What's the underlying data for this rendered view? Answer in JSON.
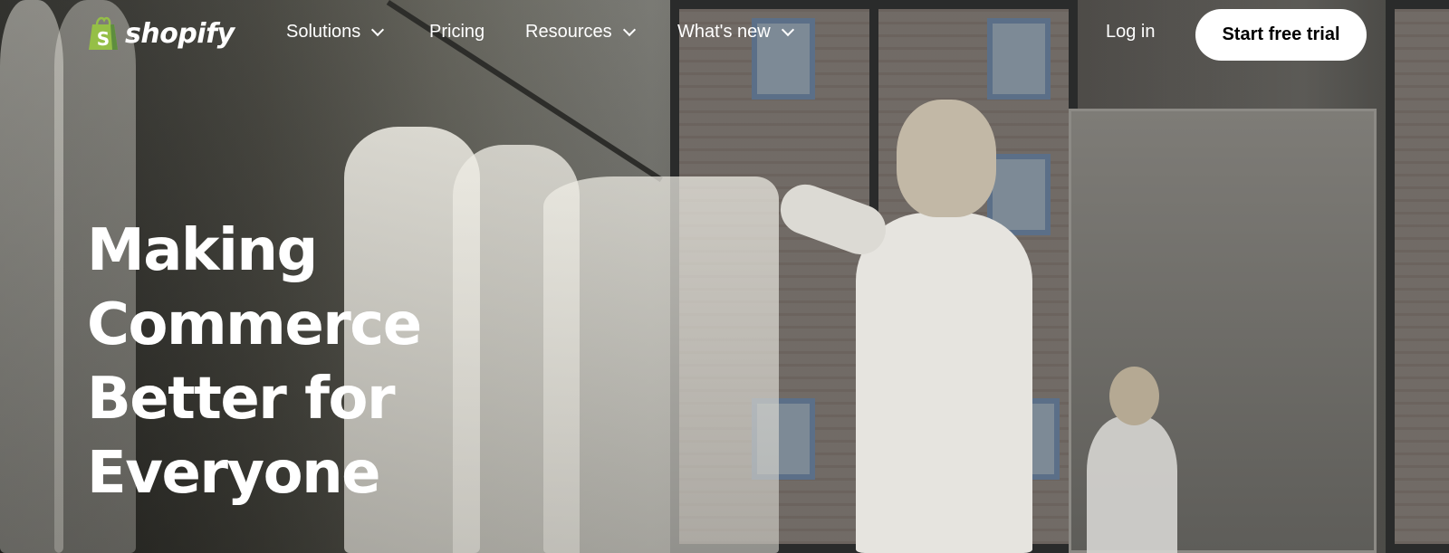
{
  "brand": {
    "name": "shopify",
    "logo_color": "#95bf47",
    "logo_dark": "#5e8e3e"
  },
  "nav": {
    "items": [
      {
        "label": "Solutions",
        "has_dropdown": true
      },
      {
        "label": "Pricing",
        "has_dropdown": false
      },
      {
        "label": "Resources",
        "has_dropdown": true
      },
      {
        "label": "What's new",
        "has_dropdown": true
      }
    ],
    "login_label": "Log in",
    "cta_label": "Start free trial"
  },
  "hero": {
    "headline_lines": [
      "Making",
      "Commerce",
      "Better for",
      "Everyone"
    ],
    "image_description": "Woman browsing white dresses on a clothing rack beside large windows"
  },
  "colors": {
    "text": "#ffffff",
    "cta_bg": "#ffffff",
    "cta_text": "#000000"
  }
}
